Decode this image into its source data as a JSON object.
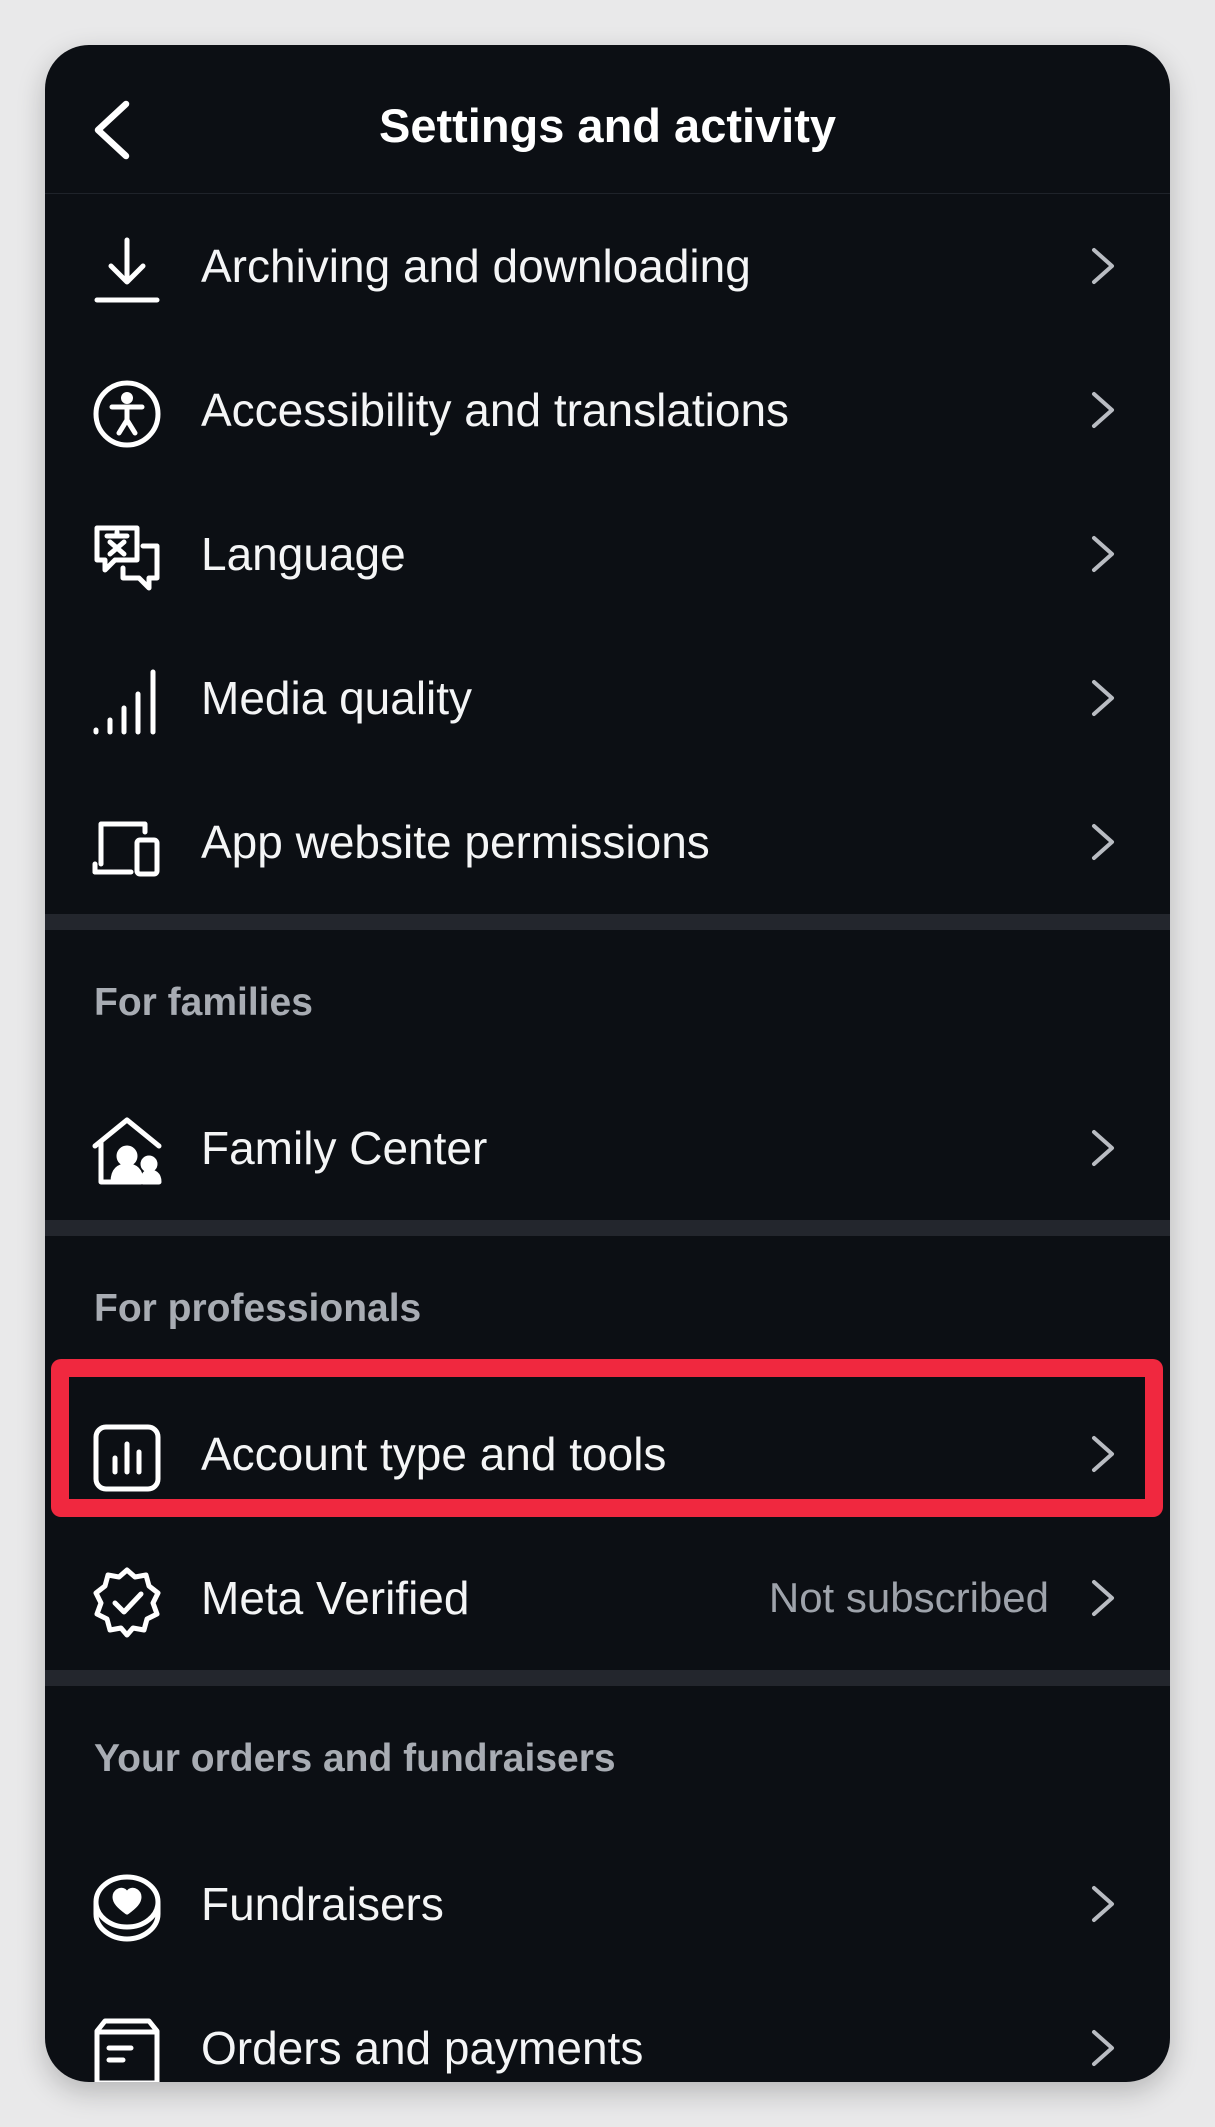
{
  "header": {
    "title": "Settings and activity"
  },
  "groups": [
    {
      "items": [
        {
          "label": "Archiving and downloading"
        },
        {
          "label": "Accessibility and translations"
        },
        {
          "label": "Language"
        },
        {
          "label": "Media quality"
        },
        {
          "label": "App website permissions"
        }
      ]
    },
    {
      "header": "For families",
      "items": [
        {
          "label": "Family Center"
        }
      ]
    },
    {
      "header": "For professionals",
      "items": [
        {
          "label": "Account type and tools"
        },
        {
          "label": "Meta Verified",
          "value": "Not subscribed"
        }
      ]
    },
    {
      "header": "Your orders and fundraisers",
      "items": [
        {
          "label": "Fundraisers"
        },
        {
          "label": "Orders and payments"
        }
      ]
    }
  ],
  "colors": {
    "background": "#0c0f14",
    "text": "#f4f5f6",
    "section_header": "#a8acb3",
    "secondary_value": "#9ea3ab",
    "divider": "#23262d",
    "highlight": "#f0283f"
  },
  "icons": {
    "back": "chevron-left-icon",
    "archiving": "download-icon",
    "accessibility": "accessibility-icon",
    "language": "translate-bubbles-icon",
    "media_quality": "signal-bars-icon",
    "app_website_permissions": "devices-icon",
    "family_center": "family-home-icon",
    "account_type": "bar-chart-icon",
    "meta_verified": "verified-badge-icon",
    "fundraisers": "heart-coin-icon",
    "orders": "receipt-box-icon",
    "row_arrow": "chevron-right-icon"
  }
}
